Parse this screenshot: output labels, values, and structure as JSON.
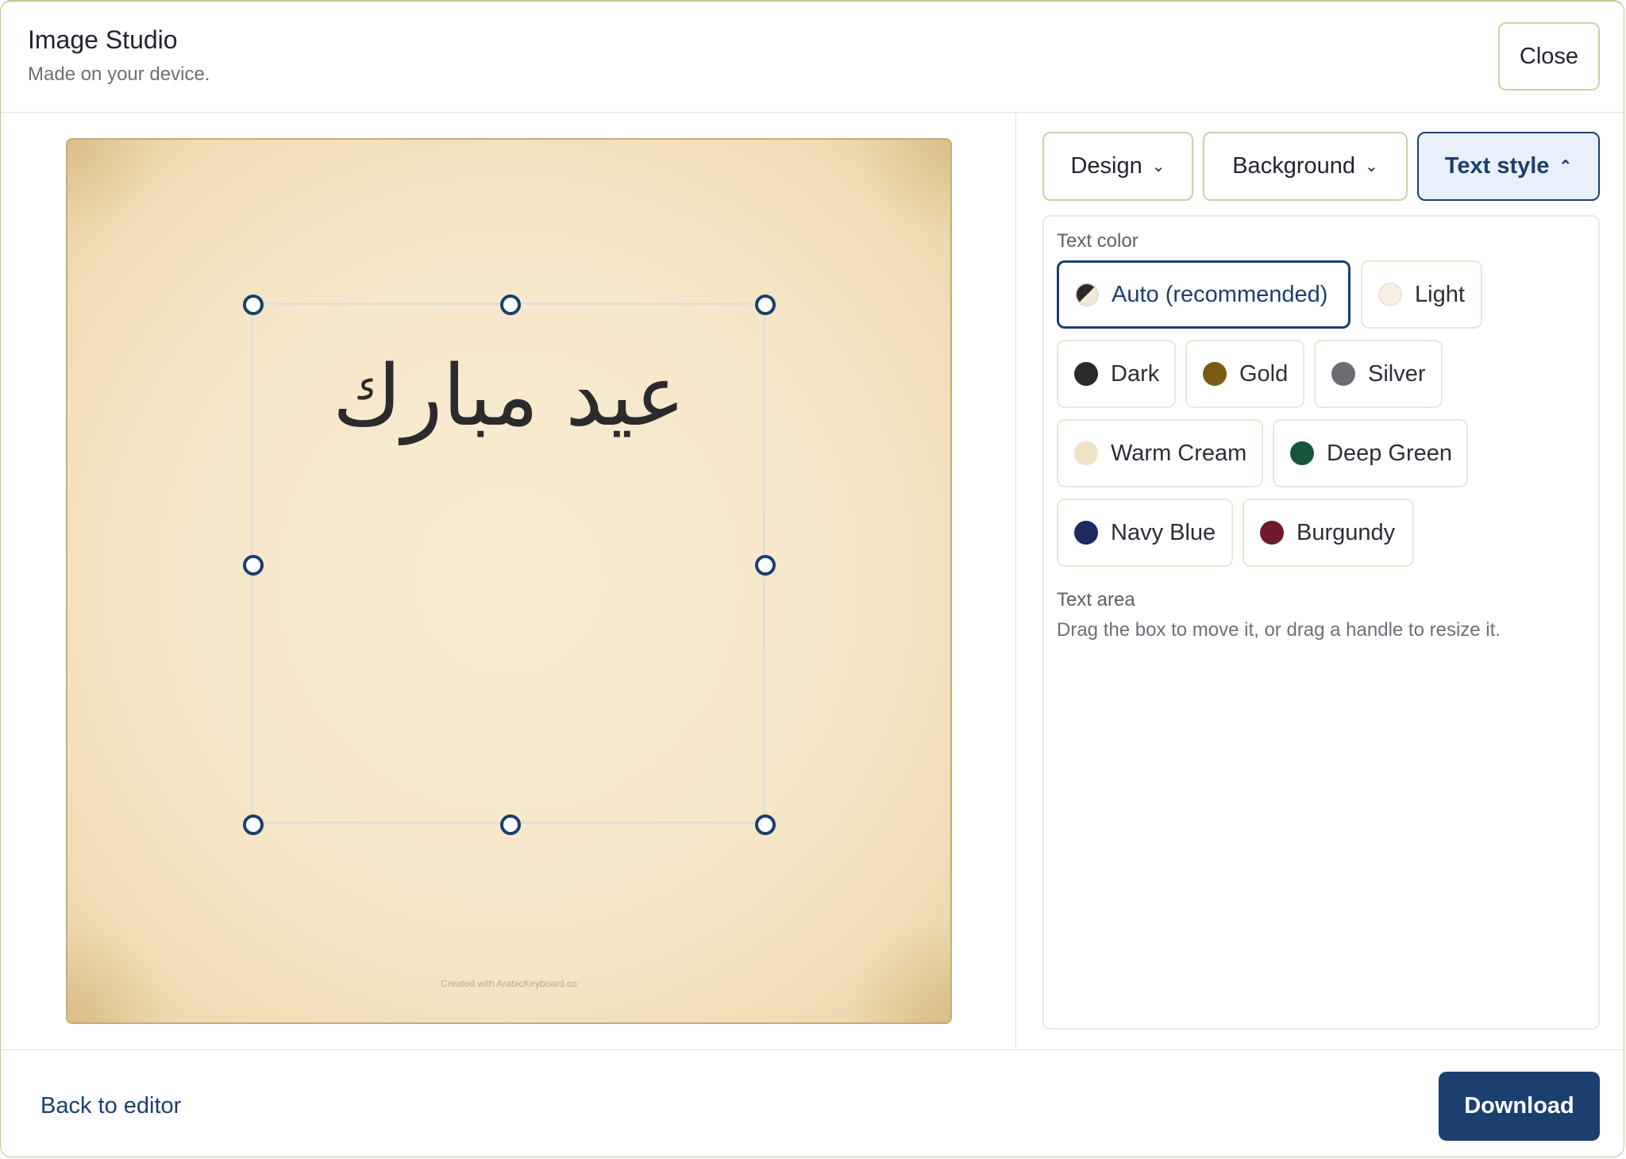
{
  "header": {
    "title": "Image Studio",
    "subtitle": "Made on your device.",
    "close_label": "Close"
  },
  "preview": {
    "greeting_text": "عيد مبارك",
    "watermark": "Created with ArabicKeyboard.co",
    "text_color": "#2b2b2b",
    "background_color": "#f6e7c9"
  },
  "tabs": [
    {
      "label": "Design",
      "icon": "chevron-down-icon",
      "active": false
    },
    {
      "label": "Background",
      "icon": "chevron-down-icon",
      "active": false
    },
    {
      "label": "Text style",
      "icon": "chevron-up-icon",
      "active": true
    }
  ],
  "text_style": {
    "color_section_label": "Text color",
    "colors": [
      {
        "label": "Auto (recommended)",
        "swatch": "auto",
        "selected": true
      },
      {
        "label": "Light",
        "swatch": "#f6efe2",
        "selected": false
      },
      {
        "label": "Dark",
        "swatch": "#2a2a2a",
        "selected": false
      },
      {
        "label": "Gold",
        "swatch": "#7c5a12",
        "selected": false
      },
      {
        "label": "Silver",
        "swatch": "#6b6d72",
        "selected": false
      },
      {
        "label": "Warm Cream",
        "swatch": "#efe2c6",
        "selected": false
      },
      {
        "label": "Deep Green",
        "swatch": "#15553a",
        "selected": false
      },
      {
        "label": "Navy Blue",
        "swatch": "#1b2b5c",
        "selected": false
      },
      {
        "label": "Burgundy",
        "swatch": "#6e1a2a",
        "selected": false
      }
    ],
    "area_section_label": "Text area",
    "area_hint": "Drag the box to move it, or drag a handle to resize it."
  },
  "footer": {
    "back_label": "Back to editor",
    "download_label": "Download"
  },
  "accent_color": "#1b3f6e"
}
